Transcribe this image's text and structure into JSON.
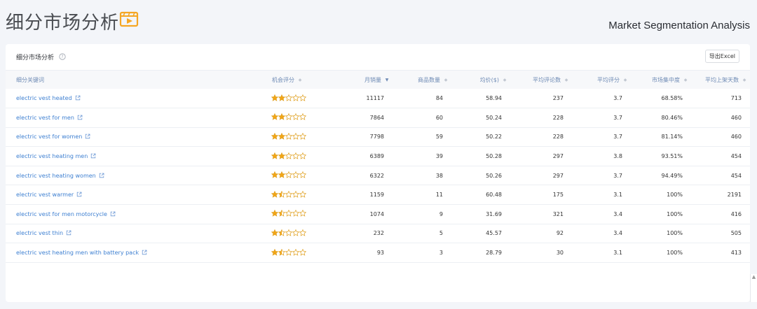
{
  "page": {
    "title": "细分市场分析",
    "subtitle": "Market Segmentation Analysis"
  },
  "card": {
    "title": "细分市场分析",
    "export_label": "导出Excel"
  },
  "table": {
    "columns": [
      "细分关键词",
      "机会评分",
      "月销量",
      "商品数量",
      "均价($)",
      "平均评论数",
      "平均评分",
      "市场集中度",
      "平均上架天数"
    ],
    "sort_column": "月销量",
    "rows": [
      {
        "keyword": "electric vest heated",
        "stars": 2,
        "monthly_sales": "11117",
        "products": "84",
        "avg_price": "58.94",
        "avg_reviews": "237",
        "avg_rating": "3.7",
        "concentration": "68.58%",
        "avg_days": "713"
      },
      {
        "keyword": "electric vest for men",
        "stars": 2,
        "monthly_sales": "7864",
        "products": "60",
        "avg_price": "50.24",
        "avg_reviews": "228",
        "avg_rating": "3.7",
        "concentration": "80.46%",
        "avg_days": "460"
      },
      {
        "keyword": "electric vest for women",
        "stars": 2,
        "monthly_sales": "7798",
        "products": "59",
        "avg_price": "50.22",
        "avg_reviews": "228",
        "avg_rating": "3.7",
        "concentration": "81.14%",
        "avg_days": "460"
      },
      {
        "keyword": "electric vest heating men",
        "stars": 2,
        "monthly_sales": "6389",
        "products": "39",
        "avg_price": "50.28",
        "avg_reviews": "297",
        "avg_rating": "3.8",
        "concentration": "93.51%",
        "avg_days": "454"
      },
      {
        "keyword": "electric vest heating women",
        "stars": 2,
        "monthly_sales": "6322",
        "products": "38",
        "avg_price": "50.26",
        "avg_reviews": "297",
        "avg_rating": "3.7",
        "concentration": "94.49%",
        "avg_days": "454"
      },
      {
        "keyword": "electric vest warmer",
        "stars": 1.5,
        "monthly_sales": "1159",
        "products": "11",
        "avg_price": "60.48",
        "avg_reviews": "175",
        "avg_rating": "3.1",
        "concentration": "100%",
        "avg_days": "2191"
      },
      {
        "keyword": "electric vest for men motorcycle",
        "stars": 1.5,
        "monthly_sales": "1074",
        "products": "9",
        "avg_price": "31.69",
        "avg_reviews": "321",
        "avg_rating": "3.4",
        "concentration": "100%",
        "avg_days": "416"
      },
      {
        "keyword": "electric vest thin",
        "stars": 1.5,
        "monthly_sales": "232",
        "products": "5",
        "avg_price": "45.57",
        "avg_reviews": "92",
        "avg_rating": "3.4",
        "concentration": "100%",
        "avg_days": "505"
      },
      {
        "keyword": "electric vest heating men with battery pack",
        "stars": 1.5,
        "monthly_sales": "93",
        "products": "3",
        "avg_price": "28.79",
        "avg_reviews": "30",
        "avg_rating": "3.1",
        "concentration": "100%",
        "avg_days": "413"
      }
    ]
  },
  "icons": {
    "title_icon": "video-play-icon",
    "help_icon": "question-circle-icon",
    "external_link_icon": "external-link-icon",
    "star_icon": "star-icon",
    "sort_icon": "sort-icon"
  },
  "colors": {
    "link": "#3d7fd1",
    "header_text": "#6f8bb5",
    "star_fill": "#f2a516",
    "icon_orange": "#f5a623"
  }
}
